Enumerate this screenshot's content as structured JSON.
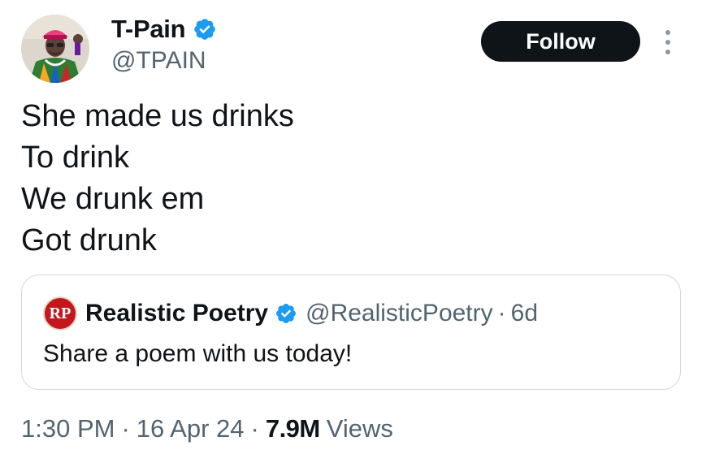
{
  "author": {
    "display_name": "T-Pain",
    "handle": "@TPAIN",
    "verified_icon": "verified-badge-icon",
    "verified_color": "#1d9bf0"
  },
  "actions": {
    "follow_label": "Follow",
    "more_icon": "more-options-icon"
  },
  "tweet": {
    "lines": [
      "She made us drinks",
      "To drink",
      "We drunk em",
      "Got drunk"
    ]
  },
  "quoted_tweet": {
    "avatar_text": "RP",
    "display_name": "Realistic Poetry",
    "handle": "@RealisticPoetry",
    "separator": "·",
    "time_ago": "6d",
    "text": "Share a poem with us today!"
  },
  "meta": {
    "time": "1:30 PM",
    "separator": "·",
    "date": "16 Apr 24",
    "views_count": "7.9M",
    "views_label": "Views"
  },
  "colors": {
    "text_primary": "#0f1419",
    "text_secondary": "#536471",
    "border": "#cfd9de",
    "follow_bg": "#0f1419",
    "quote_avatar_bg": "#c4161c"
  }
}
